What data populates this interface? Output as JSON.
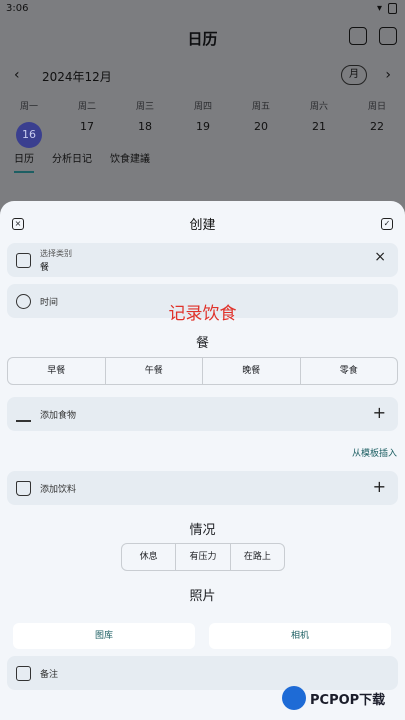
{
  "status_bar": {
    "time": "3:06"
  },
  "app": {
    "title": "日历"
  },
  "calendar": {
    "month_label": "2024年12月",
    "view_mode_button": "月",
    "weekdays": [
      {
        "day": "周一",
        "date": "16"
      },
      {
        "day": "周二",
        "date": "17"
      },
      {
        "day": "周三",
        "date": "18"
      },
      {
        "day": "周四",
        "date": "19"
      },
      {
        "day": "周五",
        "date": "20"
      },
      {
        "day": "周六",
        "date": "21"
      },
      {
        "day": "周日",
        "date": "22"
      }
    ],
    "selected_date": "16",
    "tabs": [
      "日历",
      "分析日记",
      "饮食建議"
    ]
  },
  "sheet": {
    "title": "创建",
    "category": {
      "caption": "选择类别",
      "value": "餐"
    },
    "time_label": "时间",
    "overlay_text": "记录饮食",
    "meal_heading": "餐",
    "meal_options": [
      "早餐",
      "午餐",
      "晚餐",
      "零食"
    ],
    "add_food_label": "添加食物",
    "template_link": "从模板插入",
    "add_drink_label": "添加饮料",
    "situation_heading": "情况",
    "situation_options": [
      "休息",
      "有压力",
      "在路上"
    ],
    "photo_heading": "照片",
    "gallery_button": "图库",
    "camera_button": "相机",
    "note_label": "备注"
  },
  "watermark": {
    "text": "PCPOP下载"
  },
  "colors": {
    "accent": "#1d5f63",
    "selected_date_bg": "#3a3f8f",
    "overlay_text": "#e0322a",
    "sheet_bg": "#f3f6fa",
    "card_bg": "#e6ecf2"
  }
}
